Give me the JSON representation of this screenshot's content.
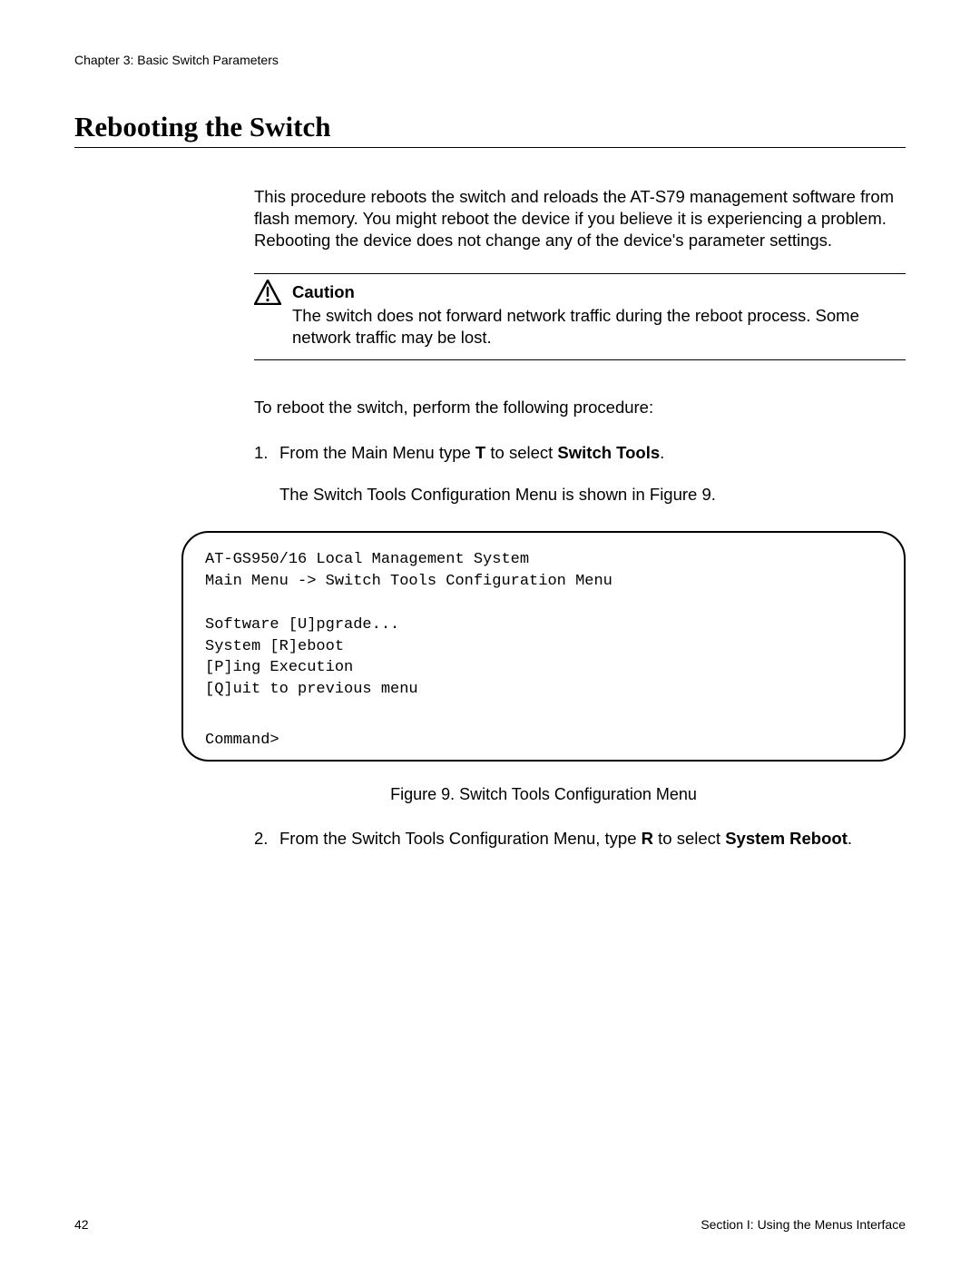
{
  "chapter": "Chapter 3: Basic Switch Parameters",
  "heading": "Rebooting the Switch",
  "intro": "This procedure reboots the switch and reloads the AT-S79 management software from flash memory. You might reboot the device if you believe it is experiencing a problem. Rebooting the device does not change any of the device's parameter settings.",
  "caution": {
    "title": "Caution",
    "text": "The switch does not forward network traffic during the reboot process. Some network traffic may be lost."
  },
  "procedure_intro": "To reboot the switch, perform the following procedure:",
  "step1": {
    "num": "1.",
    "pre": "From the Main Menu type ",
    "key": "T",
    "mid": " to select ",
    "target": "Switch Tools",
    "post": ".",
    "sub": "The Switch Tools Configuration Menu is shown in Figure 9."
  },
  "terminal": {
    "line1": "AT-GS950/16 Local Management System",
    "line2": "Main Menu -> Switch Tools Configuration Menu",
    "line3": "Software [U]pgrade...",
    "line4": "System [R]eboot",
    "line5": "[P]ing Execution",
    "line6": "[Q]uit to previous menu",
    "prompt": "Command>"
  },
  "figure_caption": "Figure 9. Switch Tools Configuration Menu",
  "step2": {
    "num": "2.",
    "pre": "From the Switch Tools Configuration Menu, type ",
    "key": "R",
    "mid": " to select ",
    "target": "System Reboot",
    "post": "."
  },
  "footer": {
    "page": "42",
    "section": "Section I: Using the Menus Interface"
  }
}
